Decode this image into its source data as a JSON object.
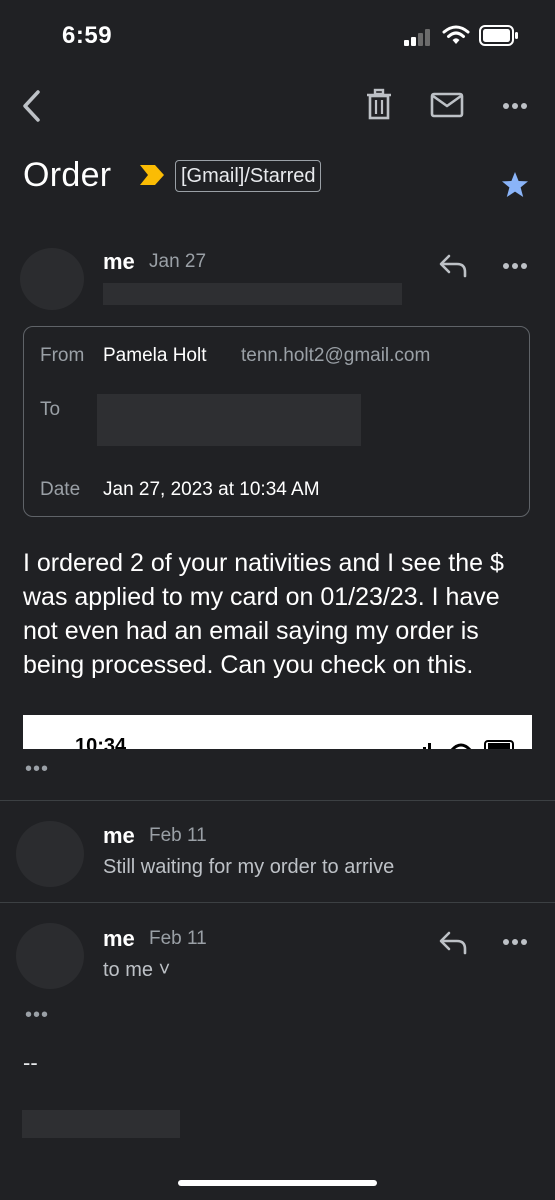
{
  "status_bar": {
    "time": "6:59"
  },
  "icons": {
    "back": "chevron-left-icon",
    "delete": "trash-icon",
    "mark_unread": "mail-icon",
    "more": "more-horizontal-icon",
    "important": "important-marker-icon",
    "star": "star-icon",
    "reply": "reply-icon"
  },
  "colors": {
    "star": "#8ab4f8",
    "important": "#fbbc04",
    "background": "#202124"
  },
  "subject": {
    "title": "Order",
    "label": "[Gmail]/Starred"
  },
  "messages": [
    {
      "sender": "me",
      "date": "Jan 27",
      "details": {
        "from_label": "From",
        "from_name": "Pamela Holt",
        "from_email": "tenn.holt2@gmail.com",
        "to_label": "To",
        "date_label": "Date",
        "date_value": "Jan 27, 2023 at 10:34 AM"
      },
      "body": "I ordered 2 of your nativities and I see the $ was applied to my card on 01/23/23. I have not even had an email saying my order is being processed. Can you check on this.",
      "attachment_preview_time": "10:34",
      "trimmed": "•••"
    },
    {
      "sender": "me",
      "date": "Feb 11",
      "snippet": "Still waiting for my order to arrive"
    },
    {
      "sender": "me",
      "date": "Feb 11",
      "recipient_line": "to me ˅",
      "trimmed": "•••",
      "signature": "--"
    }
  ]
}
